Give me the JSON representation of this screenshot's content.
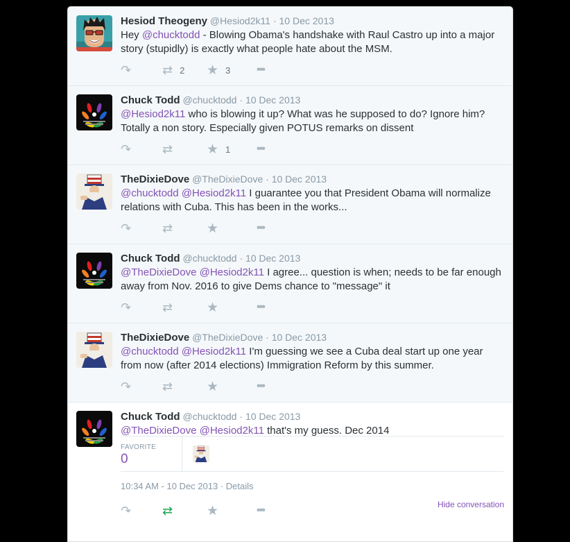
{
  "tweets": [
    {
      "avatar": "hesiod-avatar",
      "name": "Hesiod Theogeny",
      "handle": "@Hesiod2k11",
      "date": "10 Dec 2013",
      "text_parts": [
        {
          "t": "Hey ",
          "m": false
        },
        {
          "t": "@chucktodd",
          "m": true
        },
        {
          "t": " - Blowing Obama's handshake with Raul Castro up into a major story (stupidly) is exactly what people hate about the MSM.",
          "m": false
        }
      ],
      "retweets": "2",
      "favorites": "3"
    },
    {
      "avatar": "nbc-peacock-avatar",
      "name": "Chuck Todd",
      "handle": "@chucktodd",
      "date": "10 Dec 2013",
      "text_parts": [
        {
          "t": "@Hesiod2k11",
          "m": true
        },
        {
          "t": " who is blowing it up? What was he supposed to do? Ignore him? Totally a non story. Especially given POTUS remarks on dissent",
          "m": false
        }
      ],
      "retweets": "",
      "favorites": "1"
    },
    {
      "avatar": "uncle-sam-avatar",
      "name": "TheDixieDove",
      "handle": "@TheDixieDove",
      "date": "10 Dec 2013",
      "text_parts": [
        {
          "t": "@chucktodd",
          "m": true
        },
        {
          "t": " ",
          "m": false
        },
        {
          "t": "@Hesiod2k11",
          "m": true
        },
        {
          "t": " I guarantee you that President Obama will normalize relations with Cuba. This has been in the works...",
          "m": false
        }
      ],
      "retweets": "",
      "favorites": ""
    },
    {
      "avatar": "nbc-peacock-avatar",
      "name": "Chuck Todd",
      "handle": "@chucktodd",
      "date": "10 Dec 2013",
      "text_parts": [
        {
          "t": "@TheDixieDove",
          "m": true
        },
        {
          "t": " ",
          "m": false
        },
        {
          "t": "@Hesiod2k11",
          "m": true
        },
        {
          "t": " I agree... question is when; needs to be far enough away from Nov. 2016 to give Dems chance to \"message\" it",
          "m": false
        }
      ],
      "retweets": "",
      "favorites": ""
    },
    {
      "avatar": "uncle-sam-avatar",
      "name": "TheDixieDove",
      "handle": "@TheDixieDove",
      "date": "10 Dec 2013",
      "text_parts": [
        {
          "t": "@chucktodd",
          "m": true
        },
        {
          "t": " ",
          "m": false
        },
        {
          "t": "@Hesiod2k11",
          "m": true
        },
        {
          "t": " I'm guessing we see a Cuba deal start up one year from now (after 2014 elections) Immigration Reform by this summer.",
          "m": false
        }
      ],
      "retweets": "",
      "favorites": ""
    }
  ],
  "main_tweet": {
    "avatar": "nbc-peacock-avatar",
    "name": "Chuck Todd",
    "handle": "@chucktodd",
    "date": "10 Dec 2013",
    "text_parts": [
      {
        "t": "@TheDixieDove",
        "m": true
      },
      {
        "t": " ",
        "m": false
      },
      {
        "t": "@Hesiod2k11",
        "m": true
      },
      {
        "t": " that's my guess. Dec 2014",
        "m": false
      }
    ],
    "favorite_label": "FAVORITE",
    "favorite_count": "0",
    "timestamp": "10:34 AM - 10 Dec 2013",
    "separator": "·",
    "details_label": "Details",
    "hide_conversation_label": "Hide conversation"
  },
  "glyphs": {
    "dot": "·",
    "reply": "↶",
    "retweet": "⇄",
    "favorite": "★",
    "more": "•••"
  },
  "colors": {
    "mention": "#8352b6",
    "retweet_active": "#19a84c",
    "icon": "#aab8c2"
  }
}
